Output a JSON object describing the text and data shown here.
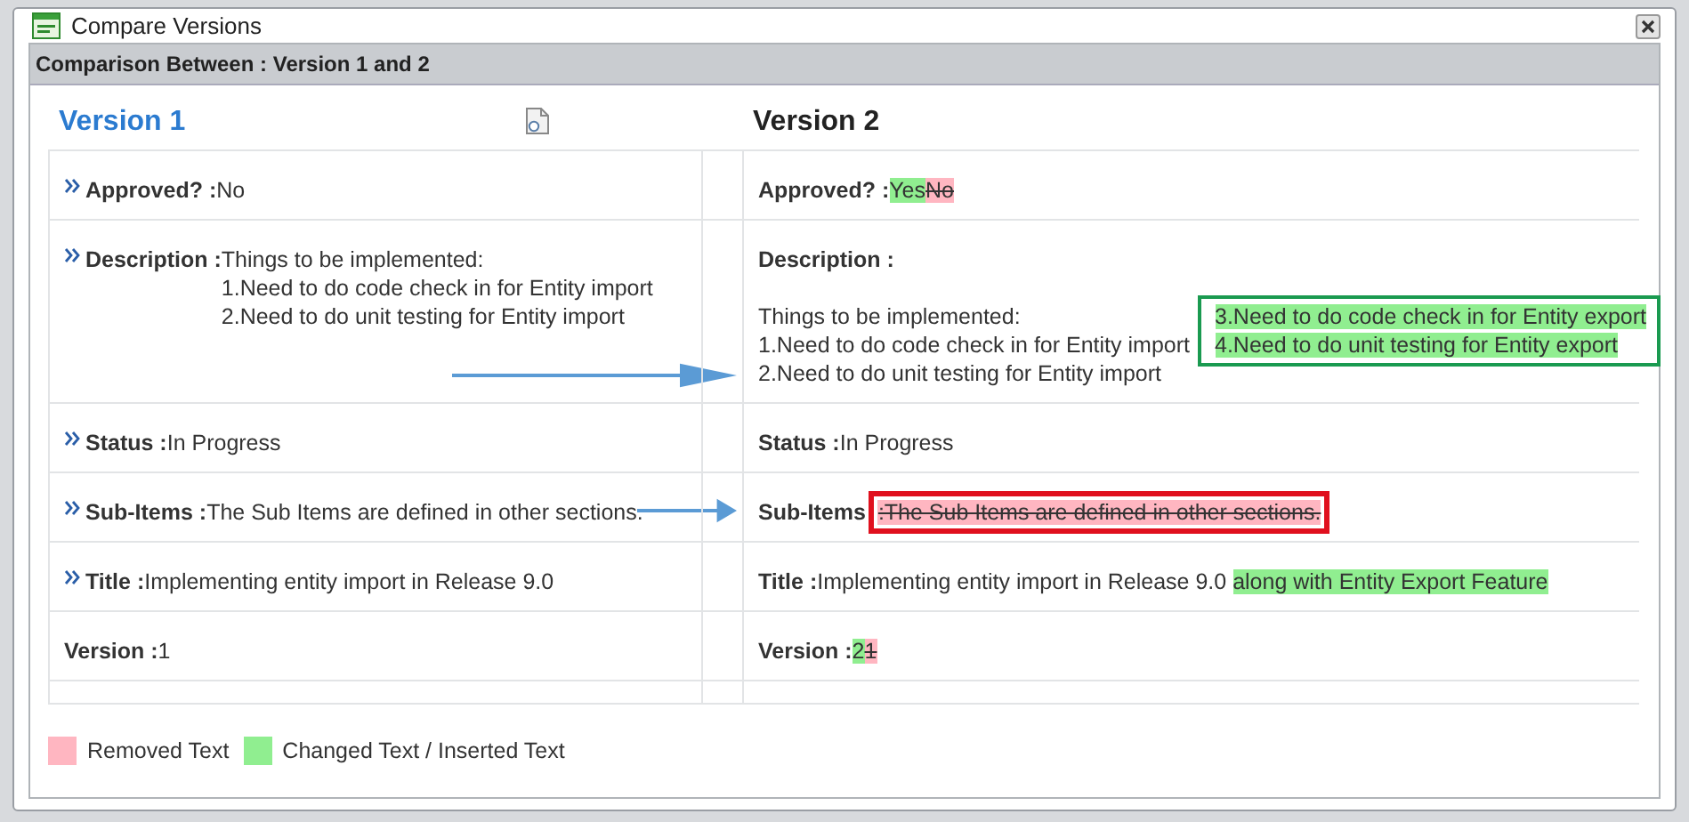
{
  "window": {
    "title": "Compare Versions"
  },
  "comparison": {
    "header": "Comparison Between : Version 1 and 2"
  },
  "columns": [
    {
      "heading": "Version 1",
      "kind": "old"
    },
    {
      "heading": "Version 2",
      "kind": "new"
    }
  ],
  "rows": [
    {
      "old": {
        "label": "Approved? :",
        "expander": true,
        "lines": [
          "No"
        ]
      },
      "new": {
        "label": "Approved? : ",
        "lines": [
          [
            {
              "text": "Yes",
              "kind": "inserted"
            },
            {
              "text": "No",
              "kind": "removed"
            }
          ]
        ]
      }
    },
    {
      "arrow": true,
      "old": {
        "label": "Description :",
        "expander": true,
        "lines": [
          "Things to be implemented:",
          "1.Need to do code check in for Entity import",
          "2.Need to do unit testing for Entity import"
        ]
      },
      "new": {
        "label": "Description :",
        "lines": [
          [
            {
              "text": "Things to be implemented:",
              "kind": "plain"
            }
          ],
          [
            {
              "text": "1.Need to do code check in for Entity import",
              "kind": "plain"
            }
          ],
          [
            {
              "text": "2.Need to do unit testing for Entity import",
              "kind": "plain"
            }
          ]
        ],
        "aside": {
          "outlined": true,
          "lines": [
            [
              {
                "text": "3.Need to do code check in for Entity export",
                "kind": "inserted"
              }
            ],
            [
              {
                "text": "4.Need to do unit testing for Entity export",
                "kind": "inserted"
              }
            ]
          ]
        }
      }
    },
    {
      "old": {
        "label": "Status :",
        "expander": true,
        "lines": [
          "In Progress"
        ]
      },
      "new": {
        "label": "Status : ",
        "lines": [
          [
            {
              "text": "In Progress",
              "kind": "plain"
            }
          ]
        ]
      }
    },
    {
      "arrow": true,
      "old": {
        "label": "Sub-Items :",
        "expander": true,
        "lines": [
          "The Sub Items are defined in other sections."
        ]
      },
      "new": {
        "label": "Sub-Items ",
        "outlined": true,
        "lines": [
          [
            {
              "text": ":The Sub Items are defined in other sections.",
              "kind": "removed"
            }
          ]
        ]
      }
    },
    {
      "old": {
        "label": "Title :",
        "expander": true,
        "lines": [
          "Implementing entity import in Release 9.0"
        ]
      },
      "new": {
        "label": "Title : ",
        "lines": [
          [
            {
              "text": "Implementing entity import in Release 9.0 ",
              "kind": "plain"
            },
            {
              "text": "along with Entity Export Feature",
              "kind": "inserted"
            }
          ]
        ]
      }
    },
    {
      "old": {
        "label": "Version :",
        "expander": false,
        "lines": [
          "1"
        ]
      },
      "new": {
        "label": "Version : ",
        "lines": [
          [
            {
              "text": "2",
              "kind": "inserted"
            },
            {
              "text": "1",
              "kind": "removed"
            }
          ]
        ]
      }
    }
  ],
  "legend": [
    {
      "label": "Removed Text",
      "color": "#ffb6c1"
    },
    {
      "label": "Changed Text / Inserted Text",
      "color": "#90ee90"
    }
  ]
}
